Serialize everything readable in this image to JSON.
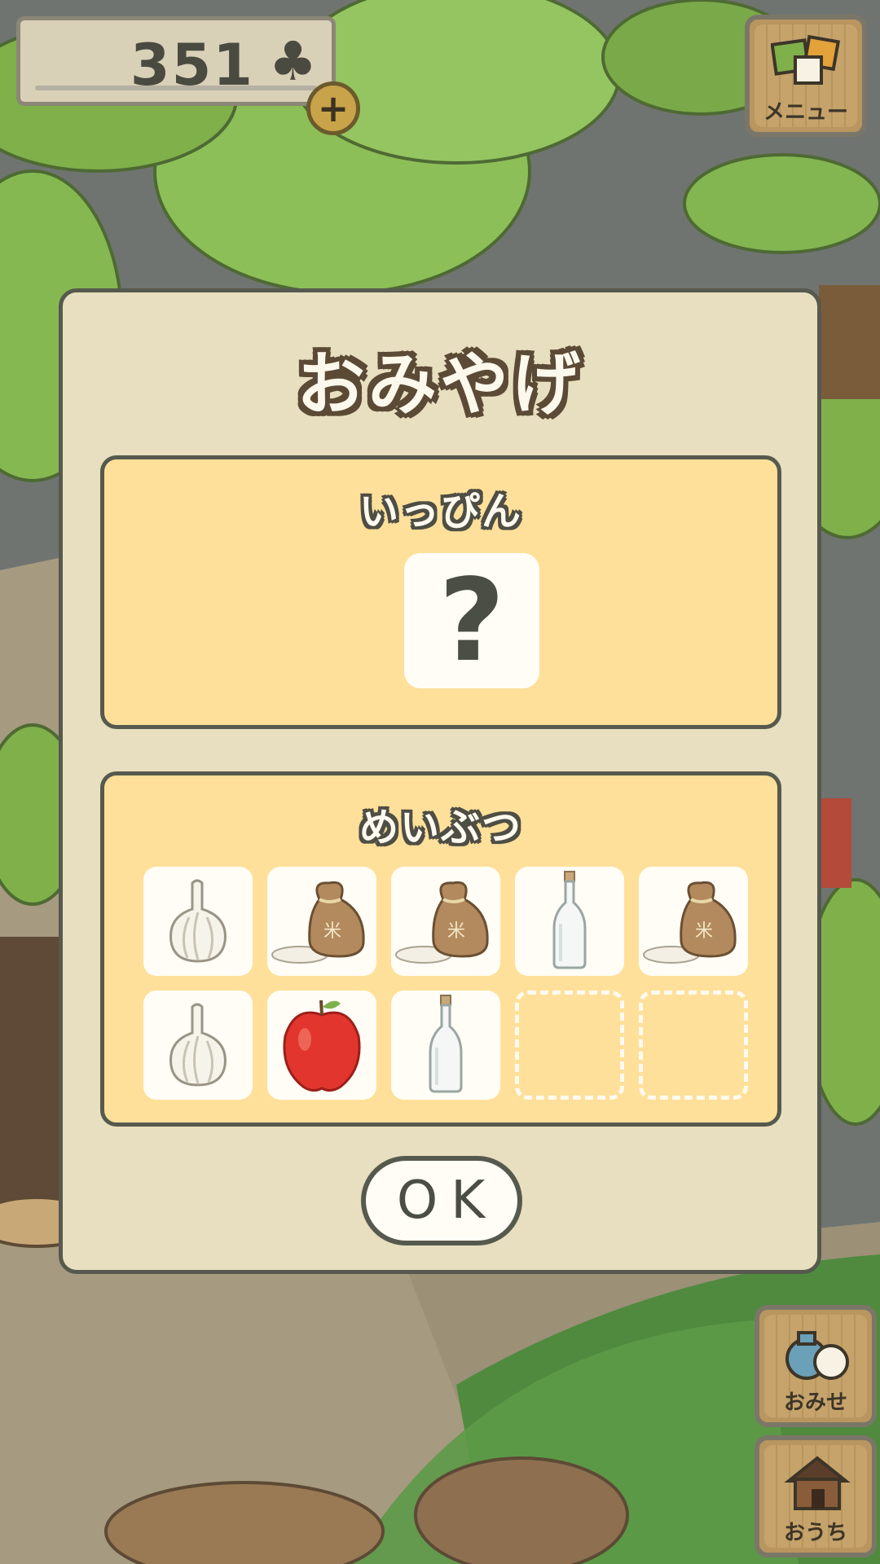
{
  "hud": {
    "clover_count": "351",
    "clover_icon": "♣",
    "plus_label": "+"
  },
  "menu_button": {
    "label": "メニュー",
    "icon": "menu-cards-icon"
  },
  "shop_button": {
    "label": "おみせ",
    "icon": "shop-bags-icon"
  },
  "home_button": {
    "label": "おうち",
    "icon": "house-icon"
  },
  "dialog": {
    "title": "おみやげ",
    "rare_section": {
      "title": "いっぴん",
      "item_placeholder": "?"
    },
    "specialty_section": {
      "title": "めいぶつ",
      "items": [
        {
          "icon": "garlic-icon"
        },
        {
          "icon": "rice-bag-icon"
        },
        {
          "icon": "rice-bag-icon"
        },
        {
          "icon": "glass-bottle-icon"
        },
        {
          "icon": "rice-bag-icon"
        },
        {
          "icon": "garlic-icon"
        },
        {
          "icon": "apple-icon"
        },
        {
          "icon": "glass-bottle-icon"
        },
        {
          "icon": "empty-slot"
        },
        {
          "icon": "empty-slot"
        }
      ]
    },
    "ok_label": "OK"
  },
  "colors": {
    "dialog_bg": "#e8dfc0",
    "panel_bg": "#ffe09a",
    "outline": "#565a4e",
    "leaf_green": "#7fb04a"
  }
}
